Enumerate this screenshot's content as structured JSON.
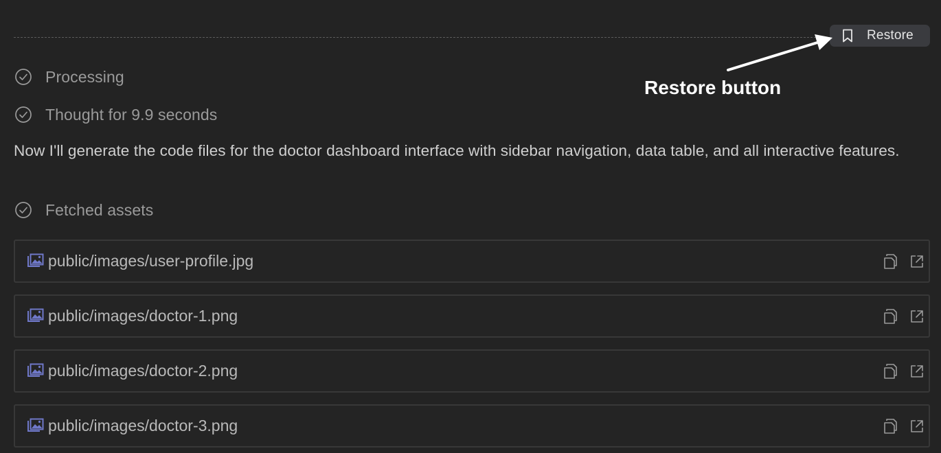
{
  "restore_button": {
    "label": "Restore",
    "icon": "bookmark-icon"
  },
  "annotation": {
    "text": "Restore button"
  },
  "steps": [
    {
      "label": "Processing",
      "icon": "check-circle-icon"
    },
    {
      "label": "Thought for 9.9 seconds",
      "icon": "check-circle-icon"
    }
  ],
  "message": {
    "text": "Now I'll generate the code files for the doctor dashboard interface with sidebar navigation, data table, and all interactive features."
  },
  "fetched_step": {
    "label": "Fetched assets",
    "icon": "check-circle-icon"
  },
  "assets": [
    {
      "path": "public/images/user-profile.jpg",
      "icon": "image-icon"
    },
    {
      "path": "public/images/doctor-1.png",
      "icon": "image-icon"
    },
    {
      "path": "public/images/doctor-2.png",
      "icon": "image-icon"
    },
    {
      "path": "public/images/doctor-3.png",
      "icon": "image-icon"
    }
  ],
  "colors": {
    "background": "#232323",
    "button_background": "#3a3b3f",
    "image_icon": "#6f78c9"
  }
}
